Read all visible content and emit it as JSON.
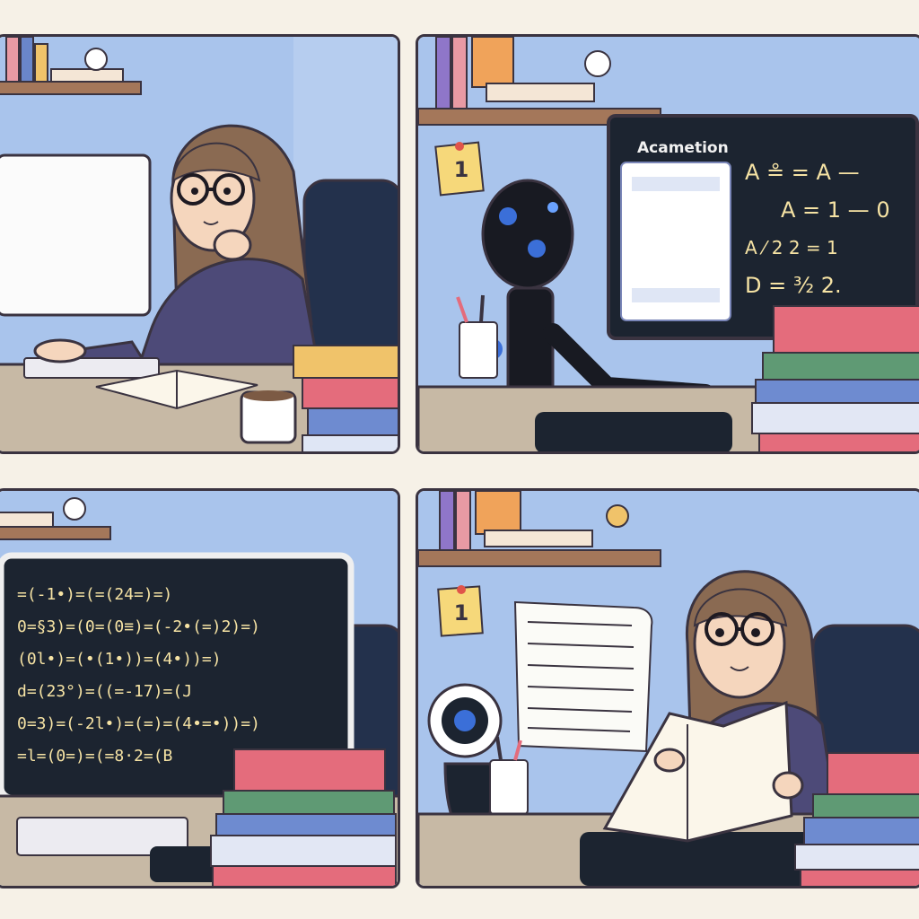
{
  "panel_tr": {
    "note": "1",
    "screen_title": "Acametion",
    "eq": [
      "A ≗ = A —",
      "A = 1 — 0",
      "A  ⁄ 2  2 = 1",
      "D = ³⁄₂  2."
    ]
  },
  "panel_bl": {
    "lines": [
      "=(-1•)=(=(24=)=)",
      "0=§3)=(0=(0≡)=(-2•(=)2)=)",
      "(0l•)=(•(1•))=(4•))=)",
      "d=(23°)=((=-17)=(J",
      "0=3)=(-2l•)=(=)=(4•=•))=)",
      "=l=(0=)=(=8·2=(B"
    ]
  },
  "panel_br": {
    "note": "1"
  },
  "colors": {
    "wall": "#a9c4ec",
    "desk": "#c7b9a5",
    "outline": "#3a3340",
    "hoodie": "#4d4a78",
    "hair": "#8a6a52",
    "chalkboard": "#1c2430",
    "chalk": "#f6e3a4"
  }
}
